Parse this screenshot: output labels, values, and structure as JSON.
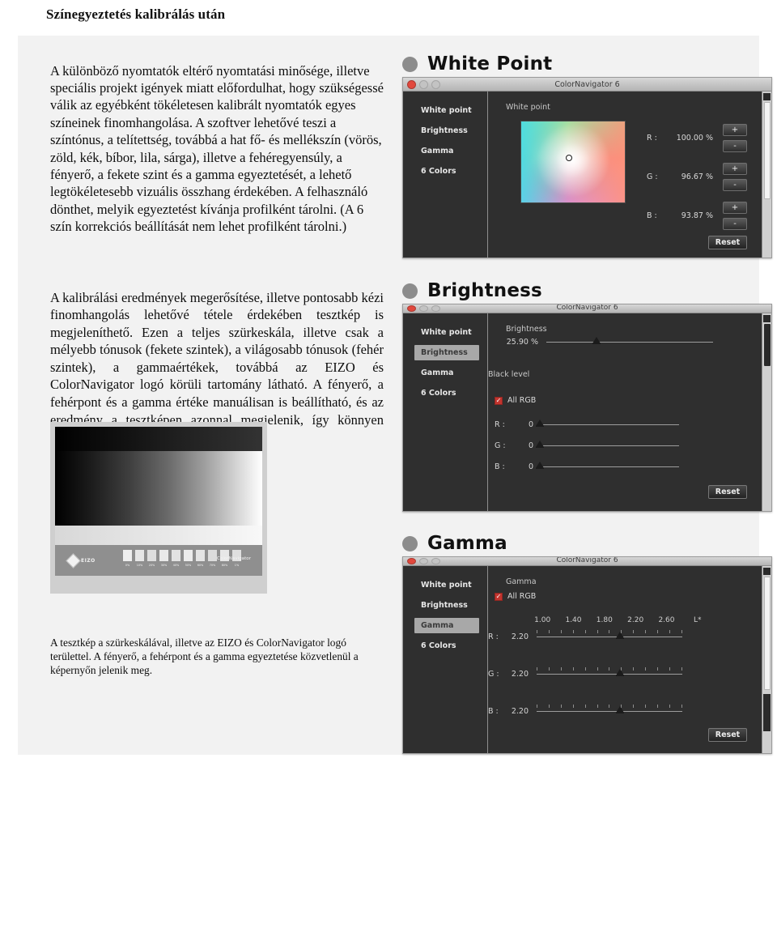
{
  "page": {
    "title": "Színegyeztetés kalibrálás után"
  },
  "paragraphs": {
    "intro": "A különböző nyomtatók eltérő nyomtatási minősége, illetve speciális projekt igények miatt előfordulhat, hogy szükségessé válik az egyébként tökéletesen kalibrált nyomtatók egyes színeinek finomhangolása. A szoftver lehetővé teszi a színtónus, a telítettség, továbbá a hat fő- és mellékszín (vörös, zöld, kék, bíbor, lila, sárga), illetve a fehéregyensúly, a fényerő, a fekete szint és a gamma egyeztetését, a lehető legtökéletesebb vizuális összhang érdekében. A felhasználó dönthet, melyik egyeztetést kívánja profilként tárolni. (A 6 szín korrekciós beállítását nem lehet profilként tárolni.)",
    "middle": "A kalibrálási eredmények megerősítése, illetve pontosabb kézi finomhangolás lehetővé tétele érdekében tesztkép is megjeleníthető. Ezen a teljes szürkeskála, illetve csak a mélyebb tónusok (fekete szintek), a világosabb tónusok (fehér szintek), a gammaértékek, továbbá az EIZO és ColorNavigator logó körüli tartomány látható. A fényerő, a fehérpont és a gamma értéke manuálisan is beállítható, és az eredmény a tesztképen azonnal megjelenik, így könnyen ellenőrizhető.",
    "caption": "A tesztkép a szürkeskálával, illetve az EIZO és ColorNavigator logó területtel. A fényerő, a fehérpont és a gamma egyeztetése közvetlenül a képernyőn jelenik meg."
  },
  "panels": {
    "white_point": {
      "heading": "White Point",
      "window_title": "ColorNavigator 6",
      "nav": [
        {
          "label": "White point",
          "active": false
        },
        {
          "label": "Brightness",
          "active": false
        },
        {
          "label": "Gamma",
          "active": false
        },
        {
          "label": "6 Colors",
          "active": false
        }
      ],
      "section_label": "White point",
      "channels": [
        {
          "key": "R :",
          "value": "100.00 %",
          "plus": "+",
          "minus": "-"
        },
        {
          "key": "G :",
          "value": "96.67 %",
          "plus": "+",
          "minus": "-"
        },
        {
          "key": "B :",
          "value": "93.87 %",
          "plus": "+",
          "minus": "-"
        }
      ],
      "reset_label": "Reset"
    },
    "brightness": {
      "heading": "Brightness",
      "window_title": "ColorNavigator 6",
      "nav": [
        {
          "label": "White point",
          "active": false
        },
        {
          "label": "Brightness",
          "active": true
        },
        {
          "label": "Gamma",
          "active": false
        },
        {
          "label": "6 Colors",
          "active": false
        }
      ],
      "section_label": "Brightness",
      "brightness_value": "25.90 %",
      "brightness_pct": 30,
      "black_level_label": "Black level",
      "all_rgb_label": "All RGB",
      "all_rgb_checked": true,
      "channels": [
        {
          "key": "R :",
          "value": "0",
          "pct": 0
        },
        {
          "key": "G :",
          "value": "0",
          "pct": 0
        },
        {
          "key": "B :",
          "value": "0",
          "pct": 0
        }
      ],
      "reset_label": "Reset"
    },
    "gamma": {
      "heading": "Gamma",
      "window_title": "ColorNavigator 6",
      "nav": [
        {
          "label": "White point",
          "active": false
        },
        {
          "label": "Brightness",
          "active": false
        },
        {
          "label": "Gamma",
          "active": true
        },
        {
          "label": "6 Colors",
          "active": false
        }
      ],
      "section_label": "Gamma",
      "all_rgb_label": "All RGB",
      "all_rgb_checked": true,
      "scale_labels": [
        "1.00",
        "1.40",
        "1.80",
        "2.20",
        "2.60",
        "L*"
      ],
      "channels": [
        {
          "key": "R :",
          "value": "2.20",
          "pct": 57
        },
        {
          "key": "G :",
          "value": "2.20",
          "pct": 57
        },
        {
          "key": "B :",
          "value": "2.20",
          "pct": 57
        }
      ],
      "reset_label": "Reset"
    }
  },
  "test_chart": {
    "logo_text": "EIZO",
    "colornavigator_text": "ColorNavigator",
    "patch_labels": [
      "0%",
      "10%",
      "20%",
      "30%",
      "40%",
      "50%",
      "60%",
      "70%",
      "80%",
      "1%"
    ],
    "patch_colors": [
      "#eeeeee",
      "#e6e6e6",
      "#dedede",
      "#e9e9e9",
      "#e2e2e2",
      "#ececec",
      "#e4e4e4",
      "#dcdcdc",
      "#e7e7e7",
      "#dfdfdf"
    ]
  },
  "colors": {
    "window_chrome": "#2f2f2f",
    "accent_red": "#c4352f",
    "heading_dot": "#8c8c8c"
  }
}
